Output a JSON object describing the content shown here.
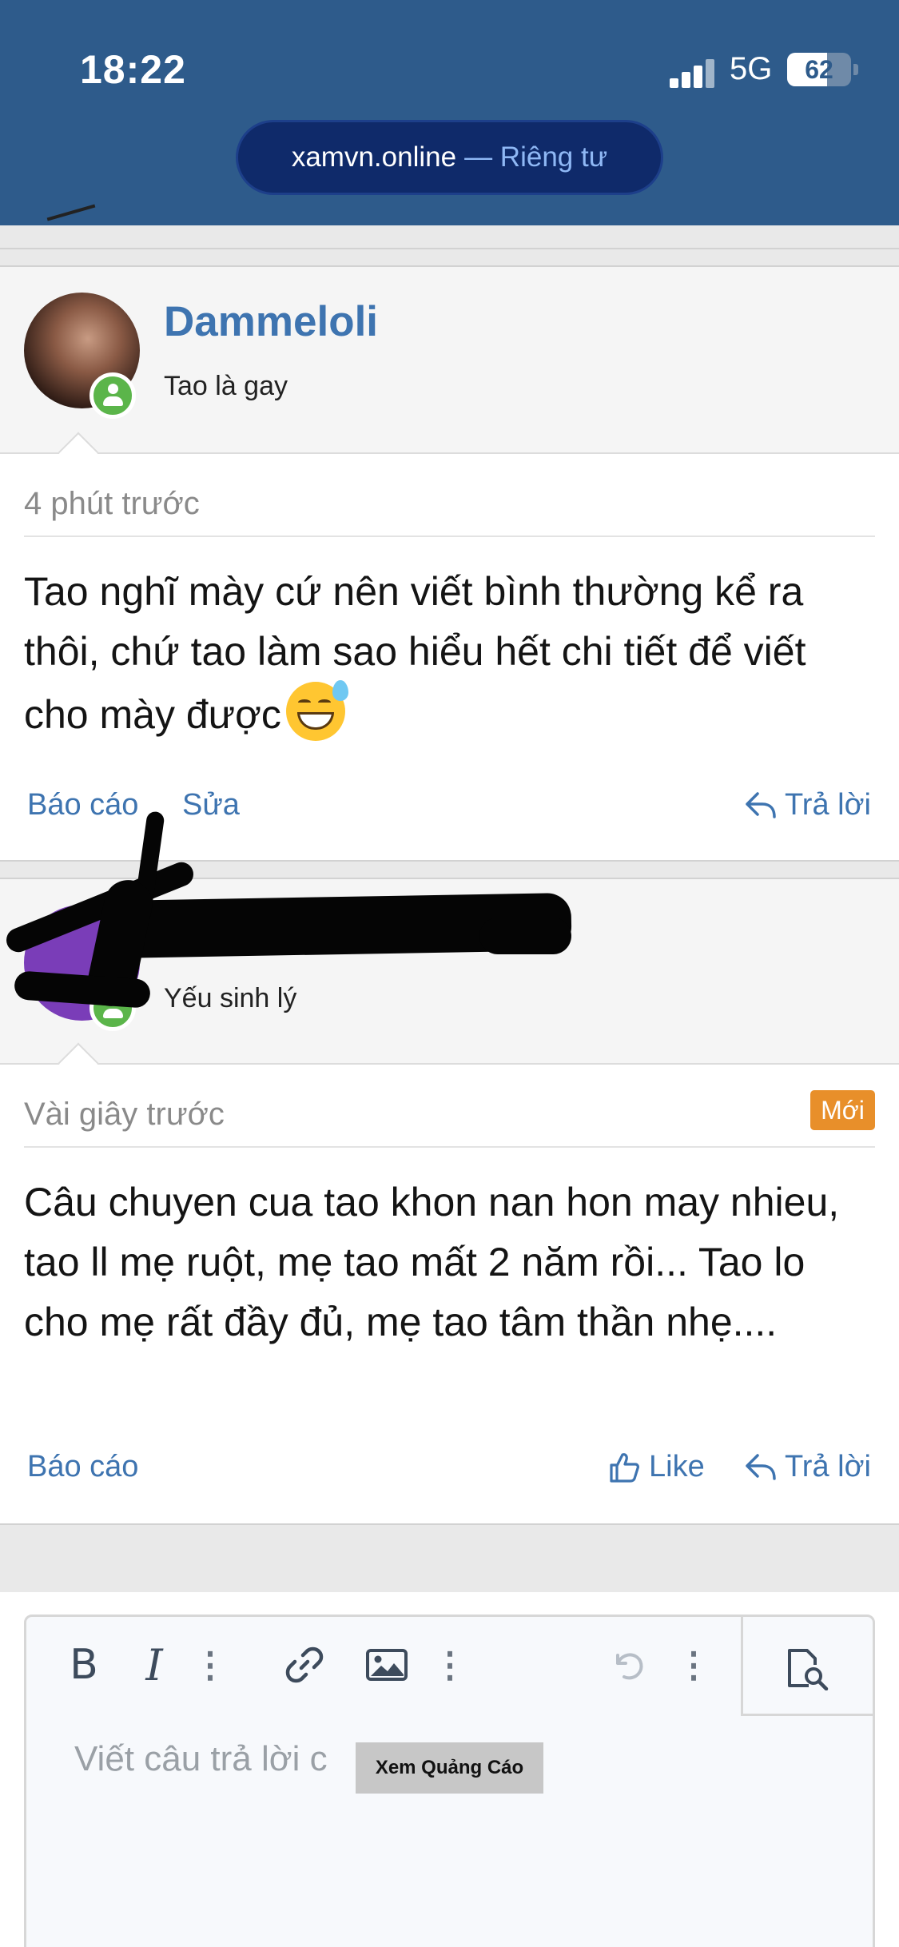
{
  "status_bar": {
    "time": "18:22",
    "network": "5G",
    "battery": "62",
    "battery_level": 0.62
  },
  "browser": {
    "domain": "xamvn.online",
    "privacy": "— Riêng tư"
  },
  "posts": [
    {
      "username": "Dammeloli",
      "user_title": "Tao là gay",
      "time": "4 phút trước",
      "content": "Tao nghĩ mày cứ nên viết bình thường kể ra thôi, chứ tao làm sao hiểu hết chi tiết để viết cho mày được",
      "actions": {
        "report": "Báo cáo",
        "edit": "Sửa",
        "reply": "Trả lời"
      },
      "emoji": "grinning-face-with-sweat"
    },
    {
      "username": "",
      "user_title": "Yếu sinh lý",
      "time": "Vài giây trước",
      "badge": "Mới",
      "content": "Câu chuyen cua tao khon nan hon may nhieu, tao ll mẹ ruột, mẹ tao mất 2 năm rồi... Tao lo cho mẹ rất đầy đủ, mẹ tao tâm thần nhẹ....",
      "actions": {
        "report": "Báo cáo",
        "like": "Like",
        "reply": "Trả lời"
      }
    }
  ],
  "editor": {
    "placeholder": "Viết câu trả lời c",
    "toolbar": [
      "bold-icon",
      "italic-icon",
      "more-icon",
      "link-icon",
      "image-icon",
      "more-icon",
      "undo-icon",
      "more-icon",
      "preview-icon"
    ],
    "bold_label": "B",
    "italic_label": "I"
  },
  "ad": {
    "label": "Xem Quảng Cáo"
  },
  "colors": {
    "header": "#2e5b8b",
    "link": "#3e74b0",
    "badge": "#e88f2a",
    "online": "#5bb54a"
  }
}
